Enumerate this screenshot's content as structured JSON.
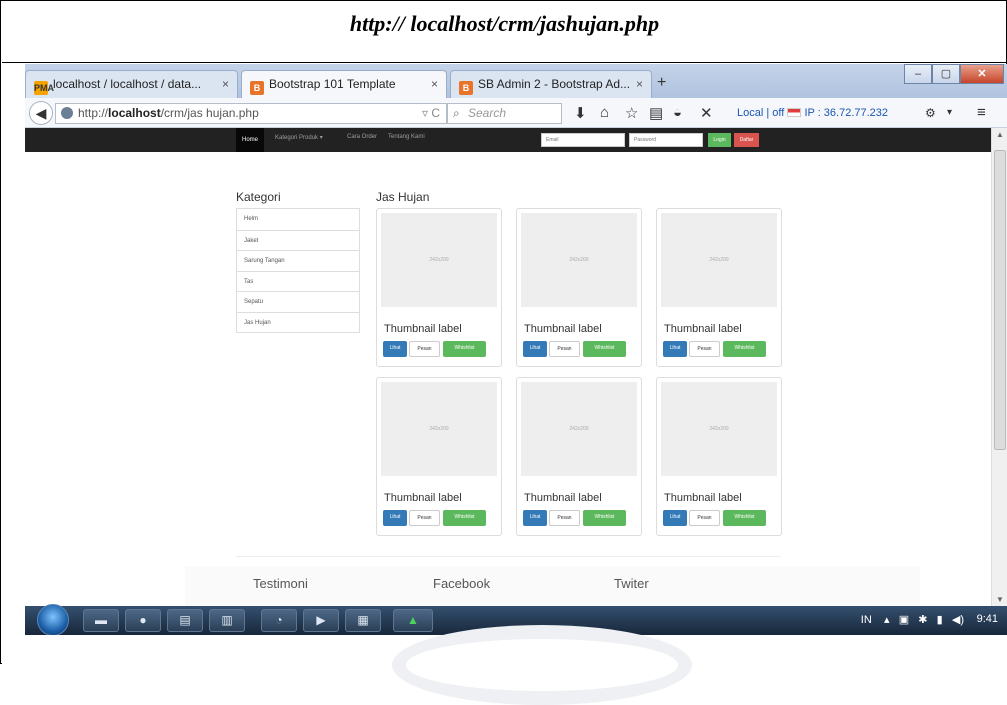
{
  "caption": "http:// localhost/crm/jashujan.php",
  "browser": {
    "tabs": [
      {
        "label": "localhost / localhost / data...",
        "close": "×"
      },
      {
        "label": "Bootstrap 101 Template",
        "close": "×"
      },
      {
        "label": "SB Admin 2 - Bootstrap Ad...",
        "close": "×"
      }
    ],
    "new_tab": "+",
    "url_prefix": "http://",
    "url_host": "localhost",
    "url_path": "/crm/jas hujan.php",
    "search_placeholder": "Search",
    "extension_text": "Local | off",
    "ip_text": "IP : 36.72.77.232"
  },
  "site": {
    "nav": {
      "home": "Home",
      "kategori": "Kategori Produk ▾",
      "cara_order": "Cara Order",
      "tentang": "Tentang Kami",
      "email_placeholder": "Email",
      "password_placeholder": "Password",
      "login": "Login",
      "daftar": "Daftar"
    },
    "kategori_title": "Kategori",
    "kategori_items": [
      "Helm",
      "Jaket",
      "Sarung Tangan",
      "Tas",
      "Sepatu",
      "Jas Hujan"
    ],
    "section_title": "Jas Hujan",
    "thumbnails": [
      {
        "placeholder": "242x200",
        "label": "Thumbnail label",
        "lihat": "Lihat",
        "pesan": "Pesan",
        "wishlist": "Whishlist"
      },
      {
        "placeholder": "242x200",
        "label": "Thumbnail label",
        "lihat": "Lihat",
        "pesan": "Pesan",
        "wishlist": "Whishlist"
      },
      {
        "placeholder": "242x200",
        "label": "Thumbnail label",
        "lihat": "Lihat",
        "pesan": "Pesan",
        "wishlist": "Whishlist"
      },
      {
        "placeholder": "242x200",
        "label": "Thumbnail label",
        "lihat": "Lihat",
        "pesan": "Pesan",
        "wishlist": "Whishlist"
      },
      {
        "placeholder": "242x200",
        "label": "Thumbnail label",
        "lihat": "Lihat",
        "pesan": "Pesan",
        "wishlist": "Whishlist"
      },
      {
        "placeholder": "242x200",
        "label": "Thumbnail label",
        "lihat": "Lihat",
        "pesan": "Pesan",
        "wishlist": "Whishlist"
      }
    ],
    "footer": {
      "testimoni": "Testimoni",
      "facebook": "Facebook",
      "twiter": "Twiter"
    }
  },
  "taskbar": {
    "tray": "IN",
    "clock": "9:41"
  },
  "colors": {
    "primary": "#337ab7",
    "success": "#5cb85c",
    "danger": "#d9534f",
    "navbar": "#222222"
  }
}
